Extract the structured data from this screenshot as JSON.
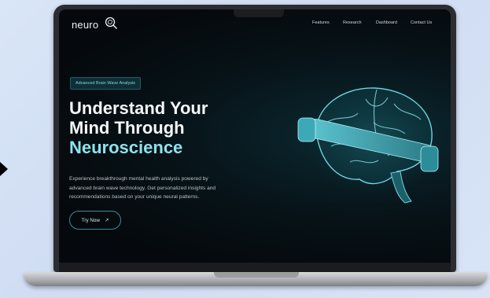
{
  "nav": {
    "logo": "neuro",
    "links": [
      "Features",
      "Research",
      "Dashboard",
      "Contact Us"
    ]
  },
  "hero": {
    "badge": "Advanced Brain Wave Analysis",
    "headline_line1": "Understand Your",
    "headline_line2": "Mind Through",
    "headline_accent": "Neuroscience",
    "description_line1": "Experience breakthrough mental health analysis powered by",
    "description_line2": "advanced brain wave technology. Get personalized insights and",
    "description_line3": "recommendations based on your unique neural patterns.",
    "cta_label": "Try Now",
    "cta_icon": "↗"
  },
  "colors": {
    "accent": "#8de3ee",
    "background": "#05090d",
    "brain": "#4fb6c4"
  },
  "icons": {
    "logo": "brain-magnifier-icon",
    "cta": "arrow-up-right-icon",
    "pointer": "triangle-arrow-icon"
  }
}
